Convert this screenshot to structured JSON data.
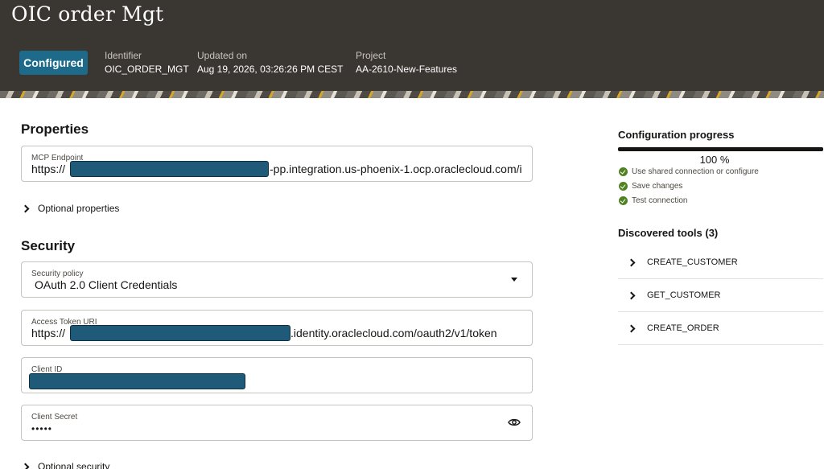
{
  "header": {
    "title": "OIC order Mgt",
    "status_badge": "Configured",
    "identifier_label": "Identifier",
    "identifier_value": "OIC_ORDER_MGT",
    "updated_label": "Updated on",
    "updated_value": "Aug 19, 2026, 03:26:26 PM CEST",
    "project_label": "Project",
    "project_value": "AA-2610-New-Features"
  },
  "properties": {
    "heading": "Properties",
    "mcp_endpoint_label": "MCP Endpoint",
    "mcp_endpoint_prefix": "https://",
    "mcp_endpoint_suffix": "-pp.integration.us-phoenix-1.ocp.oraclecloud.com/i",
    "optional_properties": "Optional properties"
  },
  "security": {
    "heading": "Security",
    "policy_label": "Security policy",
    "policy_value": "OAuth 2.0 Client Credentials",
    "token_uri_label": "Access Token URI",
    "token_uri_prefix": "https://",
    "token_uri_suffix": ".identity.oraclecloud.com/oauth2/v1/token",
    "client_id_label": "Client ID",
    "client_secret_label": "Client Secret",
    "client_secret_value": "•••••",
    "optional_security": "Optional security"
  },
  "config_progress": {
    "heading": "Configuration progress",
    "percent_text": "100 %",
    "percent_value": 100,
    "steps": [
      "Use shared connection or configure",
      "Save changes",
      "Test connection"
    ]
  },
  "tools": {
    "heading": "Discovered tools (3)",
    "items": [
      "CREATE_CUSTOMER",
      "GET_CUSTOMER",
      "CREATE_ORDER"
    ]
  },
  "colors": {
    "header_bg": "#3a3632",
    "badge_bg": "#1d6a8a",
    "success": "#508223",
    "redaction": "#1f5b78"
  },
  "icons": {
    "chevron": "chevron-right-icon",
    "dropdown": "caret-down-icon",
    "reveal": "eye-icon",
    "step_status": "check-circle-icon"
  }
}
